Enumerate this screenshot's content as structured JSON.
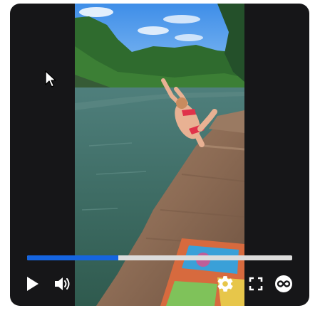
{
  "player": {
    "progress_fraction": 0.345,
    "accent_color": "#1565e0",
    "controls": {
      "play_icon": "play-icon",
      "volume_icon": "volume-icon",
      "settings_icon": "gear-icon",
      "fullscreen_icon": "fullscreen-icon",
      "loop_icon": "loop-icon"
    }
  },
  "video": {
    "scene": "person-diving-off-cliff-into-lake"
  }
}
